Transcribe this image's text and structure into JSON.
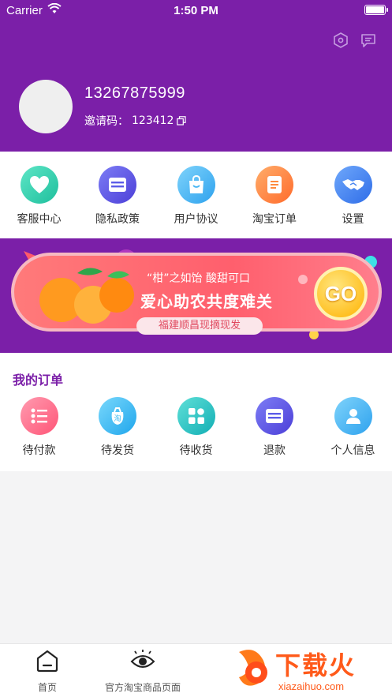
{
  "status_bar": {
    "carrier": "Carrier",
    "time": "1:50 PM"
  },
  "header": {
    "icons": [
      "settings-hex-icon",
      "message-icon"
    ],
    "phone": "13267875999",
    "invite_label": "邀请码：",
    "invite_code": "123412"
  },
  "menu": [
    {
      "label": "客服中心",
      "icon": "heart-icon",
      "color": "#2fd0b2"
    },
    {
      "label": "隐私政策",
      "icon": "card-icon",
      "color": "#5b5ce8"
    },
    {
      "label": "用户协议",
      "icon": "bag-icon",
      "color": "#49b6f4"
    },
    {
      "label": "淘宝订单",
      "icon": "list-icon",
      "color": "#ff8a3d"
    },
    {
      "label": "设置",
      "icon": "handshake-icon",
      "color": "#4a86f0"
    }
  ],
  "banner": {
    "line1": "“柑”之如饴  酸甜可口",
    "line2": "爱心助农共度难关",
    "line3": "福建顺昌现摘现发",
    "button": "GO"
  },
  "orders": {
    "title": "我的订单",
    "items": [
      {
        "label": "待付款",
        "icon": "list-stars-icon",
        "color": "#ff6a8a"
      },
      {
        "label": "待发货",
        "icon": "taobao-bag-icon",
        "color": "#36b8f0"
      },
      {
        "label": "待收货",
        "icon": "grid-icon",
        "color": "#22c4c4"
      },
      {
        "label": "退款",
        "icon": "card-icon",
        "color": "#5b5ce8"
      },
      {
        "label": "个人信息",
        "icon": "person-icon",
        "color": "#49b6f4"
      }
    ]
  },
  "tabbar": {
    "tabs": [
      {
        "label": "首页",
        "icon": "home-icon"
      },
      {
        "label": "官方淘宝商品页面",
        "icon": "eye-icon"
      }
    ]
  },
  "watermark": {
    "text": "下载火",
    "url_text": "xiazaihuo.com"
  }
}
